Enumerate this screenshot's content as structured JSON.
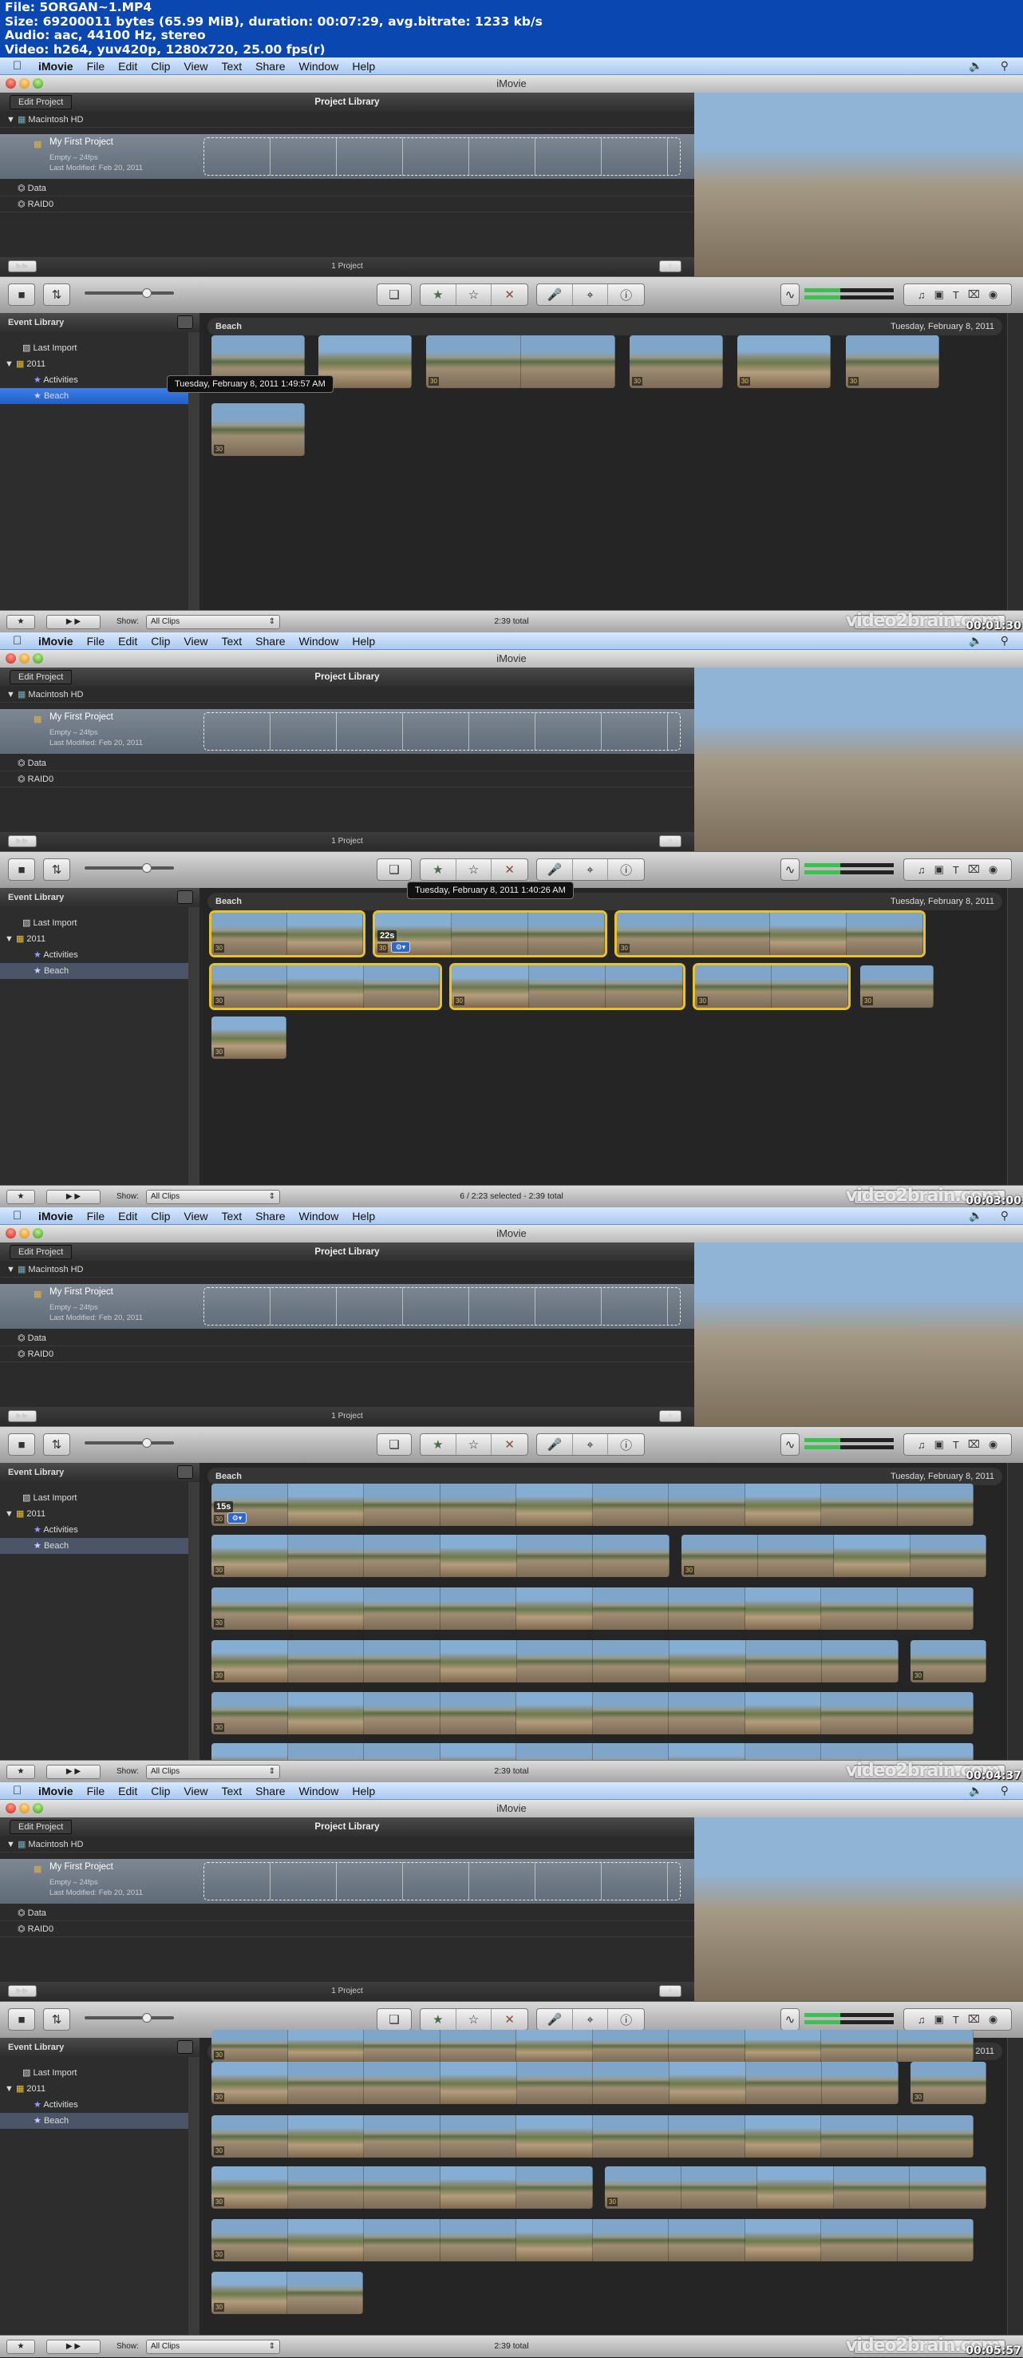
{
  "file_info": {
    "line1": "File: 5ORGAN~1.MP4",
    "line2": "Size: 69200011 bytes (65.99 MiB), duration: 00:07:29, avg.bitrate: 1233 kb/s",
    "line3": "Audio: aac, 44100 Hz, stereo",
    "line4": "Video: h264, yuv420p, 1280x720, 25.00 fps(r)"
  },
  "menubar": {
    "app": "iMovie",
    "items": [
      "File",
      "Edit",
      "Clip",
      "View",
      "Text",
      "Share",
      "Window",
      "Help"
    ]
  },
  "window_title": "iMovie",
  "project_library": {
    "edit_project": "Edit Project",
    "title": "Project Library",
    "drive": "Macintosh HD",
    "project": {
      "name": "My First Project",
      "info": "Empty – 24fps",
      "modified": "Last Modified: Feb 20, 2011"
    },
    "other_drives": [
      "Data",
      "RAID0"
    ],
    "footer": "1 Project"
  },
  "event_library": {
    "title": "Event Library",
    "items": [
      "Last Import",
      "2011",
      "Activities",
      "Beach"
    ]
  },
  "event": {
    "name": "Beach",
    "date": "Tuesday, February 8, 2011"
  },
  "bottom": {
    "show_label": "Show:",
    "show_value": "All Clips"
  },
  "watermark": "video2brain.com",
  "frames": [
    {
      "timestamp": "00:01:30",
      "status": "2:39 total",
      "tooltip": "Tuesday, February 8, 2011 1:49:57 AM",
      "sidebar_selected_style": "active"
    },
    {
      "timestamp": "00:03:00",
      "status": "6 / 2:23 selected - 2:39 total",
      "tooltip": "Tuesday, February 8, 2011 1:40:26 AM",
      "duration_label": "22s"
    },
    {
      "timestamp": "00:04:37",
      "status": "2:39 total",
      "duration_label": "15s"
    },
    {
      "timestamp": "00:05:57",
      "status": "2:39 total"
    }
  ],
  "clip_badge": "30",
  "colors": {
    "selection": "#e7c228",
    "sidebar_active": "#1f5fc8",
    "info_bar": "#0a47b0"
  }
}
